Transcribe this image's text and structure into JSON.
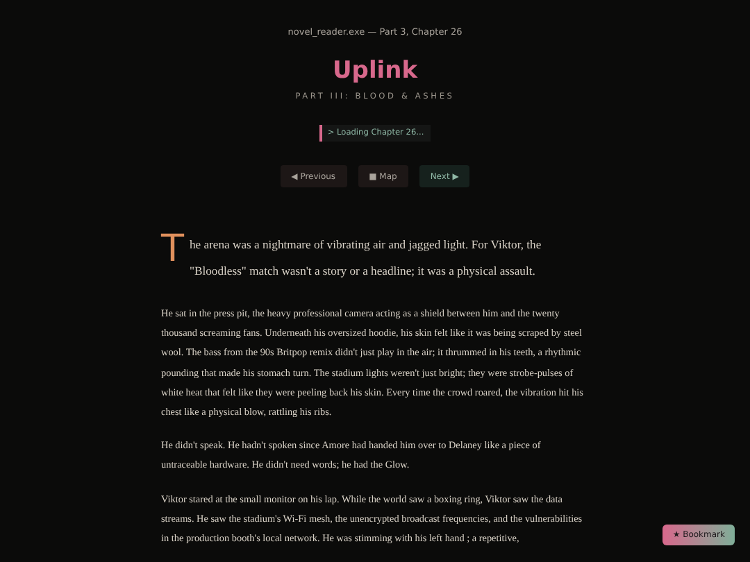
{
  "header": {
    "caption": "novel_reader.exe — Part 3, Chapter 26",
    "title": "Uplink",
    "subtitle": "PART III: BLOOD & ASHES",
    "status": "> Loading Chapter 26..."
  },
  "nav": [
    {
      "label": "◀ Previous"
    },
    {
      "label": "■ Map"
    },
    {
      "label": "Next ▶"
    }
  ],
  "paragraphs": [
    "The arena was a nightmare of vibrating air and jagged light. For Viktor, the \"Bloodless\" match wasn't a story or a headline; it was a physical assault.",
    "He sat in the press pit, the heavy professional camera acting as a shield between him and the twenty thousand screaming fans. Underneath his oversized hoodie, his skin felt like it was being scraped by steel wool. The bass from the 90s Britpop remix didn't just play in the air; it thrummed in his teeth, a rhythmic pounding that made his stomach turn. The stadium lights weren't just bright; they were strobe-pulses of white heat that felt like they were peeling back his skin. Every time the crowd roared, the vibration hit his chest like a physical blow, rattling his ribs.",
    "He didn't speak. He hadn't spoken since Amore had handed him over to Delaney like a piece of untraceable hardware. He didn't need words; he had the Glow.",
    "Viktor stared at the small monitor on his lap. While the world saw a boxing ring, Viktor saw the data streams. He saw the stadium's Wi-Fi mesh, the unencrypted broadcast frequencies, and the vulnerabilities in the production booth's local network. He was stimming with his left hand ; a repetitive,"
  ],
  "bookmark": {
    "label": "★ Bookmark"
  }
}
